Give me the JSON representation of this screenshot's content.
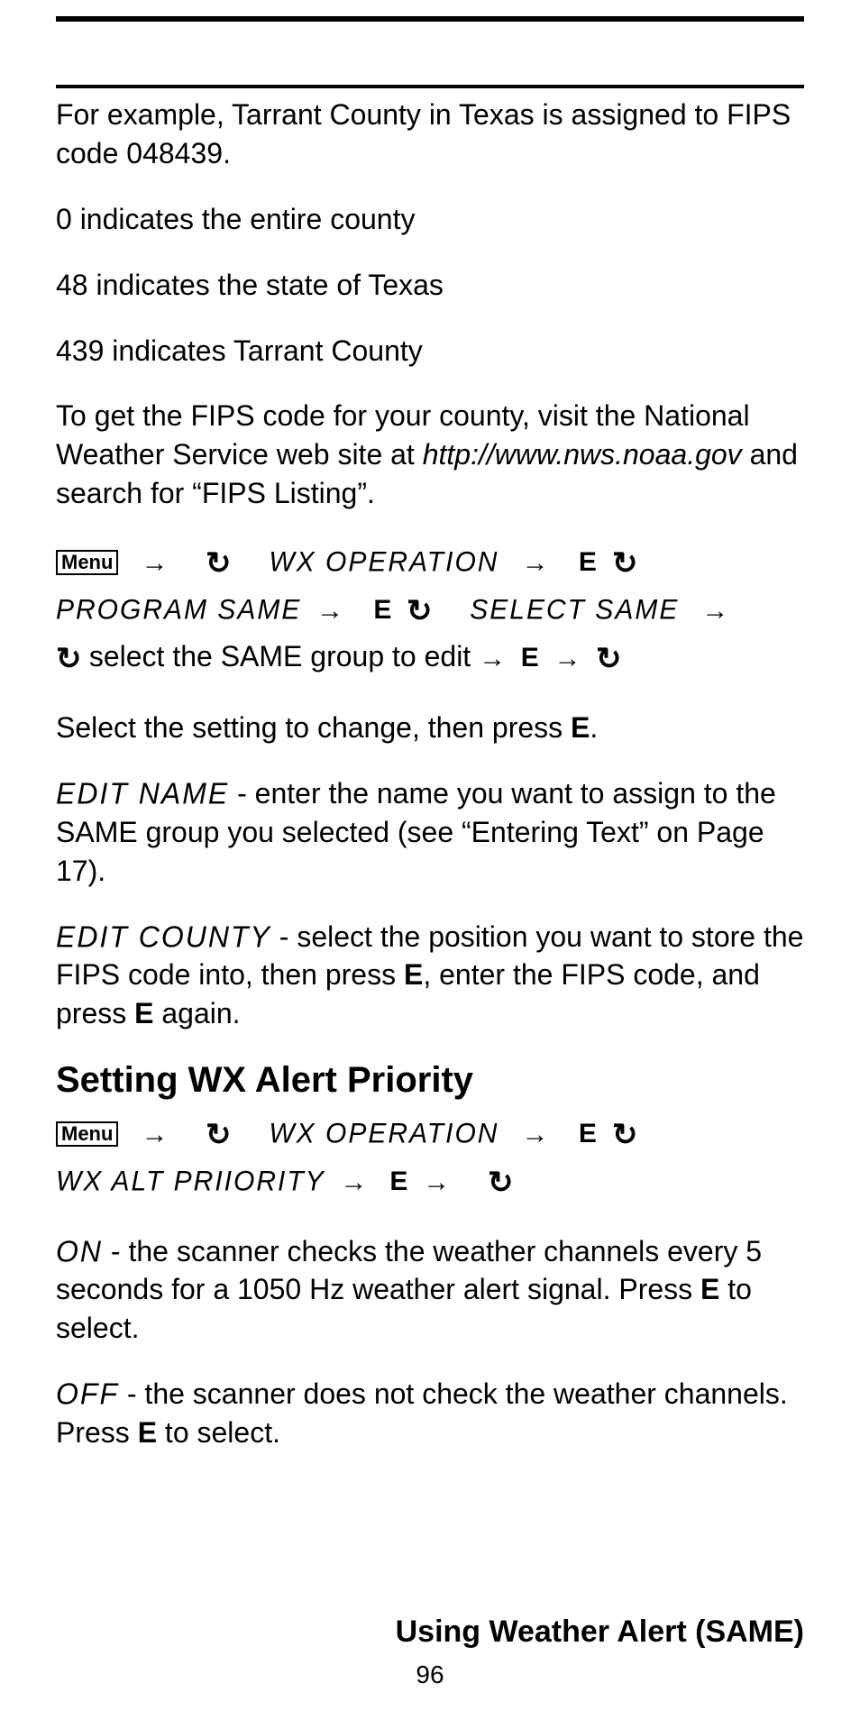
{
  "paragraphs": {
    "p1": "For example, Tarrant County in Texas is assigned to FIPS code 048439.",
    "p2": "0 indicates the entire county",
    "p3": "48 indicates the state of Texas",
    "p4": "439 indicates Tarrant County",
    "p5a": "To get the FIPS code for your county, visit the National Weather Service web site at ",
    "p5b": "http://www.nws.noaa.gov",
    "p5c": " and search for “FIPS Listing”.",
    "p6a": "Select the setting to change, then press ",
    "p6b": ".",
    "p7a": " - enter the name you want to assign to the SAME group you selected (see “Entering Text” on Page 17).",
    "p8a": " - select the position you want to store the FIPS code into, then press ",
    "p8b": ", enter the FIPS code, and press ",
    "p8c": " again.",
    "p9a": " - the scanner checks the weather channels every 5 seconds for a 1050 Hz weather alert signal. Press ",
    "p9b": " to select.",
    "p10a": " - the scanner does not check the weather channels. Press ",
    "p10b": " to select."
  },
  "heading": "Setting WX Alert Priority",
  "nav": {
    "menu": "Menu",
    "wx_operation": "WX OPERATION",
    "program_same": "PROGRAM SAME",
    "select_same": "SELECT SAME",
    "select_group": " select the SAME group to edit ",
    "wx_alt_priority": "WX ALT PRIIORITY",
    "edit_name": "EDIT NAME",
    "edit_county": "EDIT COUNTY",
    "on": "ON",
    "off": "OFF",
    "key_e": "E"
  },
  "footer": {
    "title": "Using Weather Alert (SAME)",
    "page": "96"
  }
}
